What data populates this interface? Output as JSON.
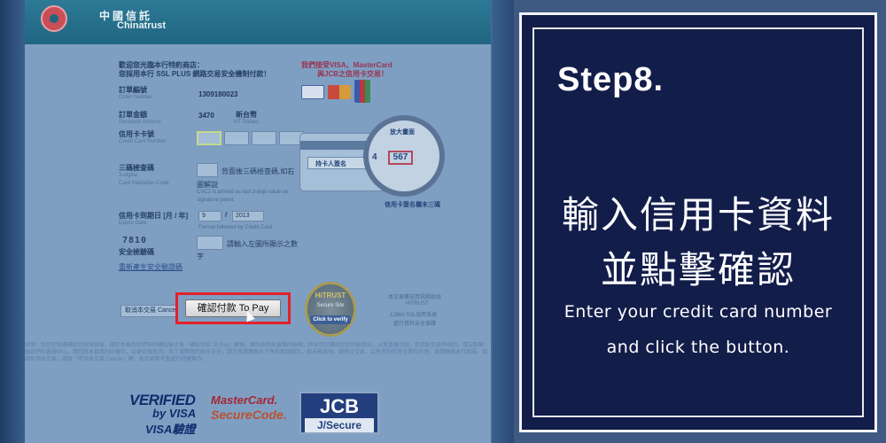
{
  "bank": {
    "name_zh": "中國信託",
    "name_en": "Chinatrust"
  },
  "payment_form": {
    "welcome_line1": "歡迎您光臨本行特約商店：",
    "welcome_line2": "您採用本行 SSL PLUS 網路交易安全機制付款！",
    "accept_line1": "我們接受VISA、MasterCard",
    "accept_line2": "與JCB之信用卡交易！",
    "order_no": {
      "label_zh": "訂單編號",
      "label_en": "Order Number",
      "value": "1309180023"
    },
    "amount": {
      "label_zh": "訂單金額",
      "label_en": "Purchase Amount",
      "value": "3470",
      "currency_zh": "新台幣",
      "currency_en": "NT Dollars"
    },
    "card_no": {
      "label_zh": "信用卡卡號",
      "label_en": "Credit Card Number"
    },
    "cvv": {
      "label_zh": "三碼檢查碼",
      "label_en_1": "3-digital",
      "label_en_2": "Card Validation Code",
      "hint_zh": "背面後三碼檢查碼,如右",
      "hint_zh_2": "圖解說",
      "hint_en_1": "CVC2 is printed as last 3-digit value on",
      "hint_en_2": "signature panel."
    },
    "expiry": {
      "label_zh": "信用卡到期日 [月 / 年]",
      "label_en": "Expire Date",
      "month": "9",
      "year": "2013",
      "hint_en": "Format followed by Credit Card"
    },
    "captcha": {
      "code": "7810",
      "label_zh": "安全檢驗碼",
      "hint_zh": "請輸入左圖所顯示之數",
      "hint_zh_2": "字",
      "refresh_link": "重新產生安全驗證碼"
    },
    "card_diagram": {
      "zoom_label": "放大畫面",
      "sig_label": "持卡人簽名",
      "digit_prefix": "4",
      "cvv_sample": "567",
      "caption": "信用卡簽名欄末三碼"
    },
    "cancel_button": "取消本交易 Cancel",
    "pay_button": "確認付款 To Pay",
    "trust_seal": {
      "title": "HiTRUST",
      "subtitle": "Secure Site",
      "link": "Click to verify"
    },
    "right_note_1": "本交易傳送資訊將經由",
    "right_note_2": "HiTRUST",
    "right_note_3": "128bit SSL加密系統",
    "right_note_4": "進行資料安全保護",
    "footer_note": "說明：如您在點選確認付款按鈕後，請於本頁作好資料的確認後才按「確認付款 To Pay」鍵後，請勿按到本頁面的按鈕。除非您已確認您的付款資訊，以免重複付款，若您對交易有疑問，請立即聯絡我們的客服中心。請您將本頁面列印留存，以便日後查詢。為了保障您的刷卡安全，請注意瀏覽器右下角的鎖頭圖示，如未能出現，請停止交易，以免您的信用卡資料外洩，並請聯絡本行客服。如欲取消本交易，請按「取消本交易 Cancel」鍵，本交易將不會進行授權動作。",
    "logos": {
      "verified_visa": [
        "VERIFIED",
        "by VISA",
        "VISA驗證"
      ],
      "mastercard_secure": [
        "MasterCard.",
        "SecureCode."
      ],
      "jcb_secure": [
        "JCB",
        "J/Secure"
      ]
    }
  },
  "instruction": {
    "step": "Step8.",
    "zh_line1": "輸入信用卡資料",
    "zh_line2": "並點擊確認",
    "en_line1": "Enter your credit card number",
    "en_line2": "and click the button."
  }
}
